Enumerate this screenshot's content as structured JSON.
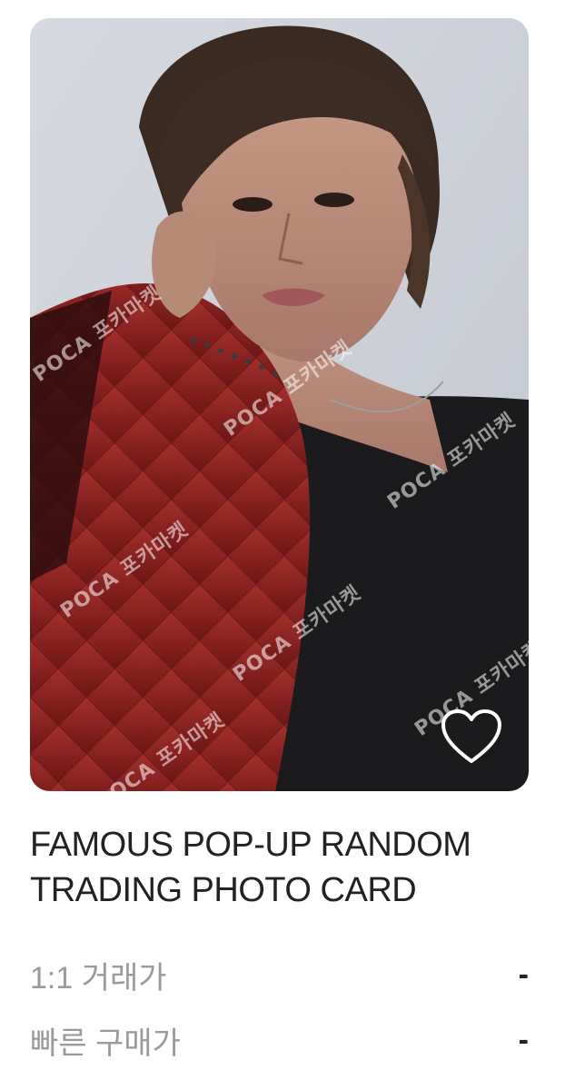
{
  "product": {
    "title_line1": "FAMOUS POP-UP RANDOM",
    "title_line2": "TRADING PHOTO CARD",
    "watermark_text": "POCA 포카마켓",
    "image_alt": "photo card image",
    "favorite_icon": "heart-outline-icon"
  },
  "prices": [
    {
      "label": "1:1 거래가",
      "value": "-"
    },
    {
      "label": "빠른 구매가",
      "value": "-"
    }
  ],
  "colors": {
    "text_primary": "#222222",
    "text_secondary": "#9a9a9a",
    "photo_background": "#cfd3da",
    "jacket_red": "#8e1f1f",
    "shirt_black": "#1b1b1d"
  }
}
